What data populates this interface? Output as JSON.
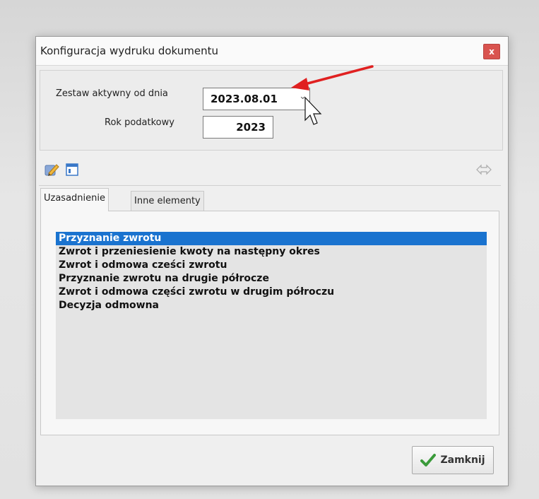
{
  "window": {
    "title": "Konfiguracja wydruku dokumentu",
    "close_glyph": "x"
  },
  "settings": {
    "active_from_label": "Zestaw aktywny od dnia",
    "active_from_value": "2023.08.01",
    "tax_year_label": "Rok podatkowy",
    "tax_year_value": "2023"
  },
  "toolbar": {
    "icons": [
      "edit-icon",
      "window-icon",
      "link-arrows-icon"
    ]
  },
  "tabs": [
    {
      "label": "Uzasadnienie",
      "active": true
    },
    {
      "label": "Inne elementy",
      "active": false
    }
  ],
  "list": {
    "items": [
      {
        "label": "Przyznanie zwrotu",
        "selected": true
      },
      {
        "label": "Zwrot i przeniesienie kwoty na następny okres",
        "selected": false
      },
      {
        "label": "Zwrot i odmowa cześci zwrotu",
        "selected": false
      },
      {
        "label": "Przyznanie zwrotu na drugie półrocze",
        "selected": false
      },
      {
        "label": "Zwrot i odmowa części zwrotu w drugim półroczu",
        "selected": false
      },
      {
        "label": "Decyzja odmowna",
        "selected": false
      }
    ]
  },
  "footer": {
    "close_label": "Zamknij"
  },
  "colors": {
    "selection": "#1a73cf",
    "close_button": "#d9534f",
    "annotation_arrow": "#e02020"
  }
}
